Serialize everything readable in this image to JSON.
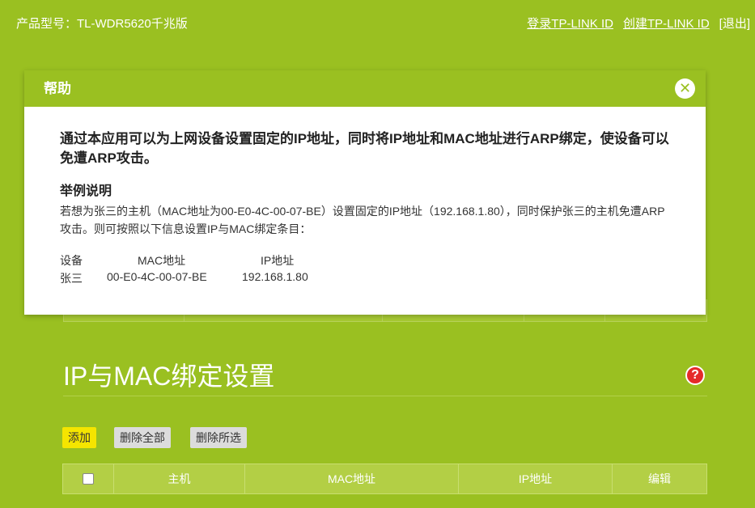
{
  "header": {
    "product_label": "产品型号：TL-WDR5620千兆版",
    "login_link": "登录TP-LINK ID",
    "create_link": "创建TP-LINK ID",
    "logout_link": "[退出]"
  },
  "section": {
    "title": "IP与MAC绑定设置",
    "help_icon": "?"
  },
  "toolbar": {
    "add_label": "添加",
    "delete_all_label": "删除全部",
    "delete_selected_label": "删除所选"
  },
  "table": {
    "columns": [
      "主机",
      "MAC地址",
      "IP地址",
      "编辑"
    ]
  },
  "modal": {
    "title": "帮助",
    "close_icon": "✕",
    "intro": "通过本应用可以为上网设备设置固定的IP地址，同时将IP地址和MAC地址进行ARP绑定，使设备可以免遭ARP攻击。",
    "example_title": "举例说明",
    "example_text": "若想为张三的主机（MAC地址为00-E0-4C-00-07-BE）设置固定的IP地址（192.168.1.80），同时保护张三的主机免遭ARP攻击。则可按照以下信息设置IP与MAC绑定条目：",
    "example_table": {
      "headers": [
        "设备",
        "MAC地址",
        "IP地址"
      ],
      "row": [
        "张三",
        "00-E0-4C-00-07-BE",
        "192.168.1.80"
      ]
    }
  },
  "colors": {
    "background": "#9ac021",
    "add_button": "#f5e500",
    "help_button": "#e52a2a"
  }
}
